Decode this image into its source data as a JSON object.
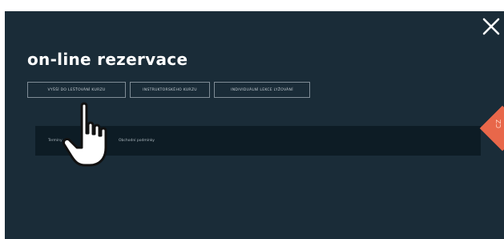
{
  "modal": {
    "title": "on-line rezervace",
    "close_icon": "close-icon"
  },
  "buttons": [
    {
      "label": "Vyšší do lešťování kurzu"
    },
    {
      "label": "Instruktorského kurzu"
    },
    {
      "label": "Individuální lekce lyžování"
    }
  ],
  "panel": {
    "left_label": "Termíny",
    "right_label": "Obchodní podmínky"
  },
  "side_tab": {
    "label": "CZ"
  },
  "cursor": {
    "icon": "hand-pointer-icon"
  },
  "colors": {
    "background": "#1a2c38",
    "panel": "#0d1c25",
    "accent": "#e8674a",
    "text": "#ffffff"
  }
}
